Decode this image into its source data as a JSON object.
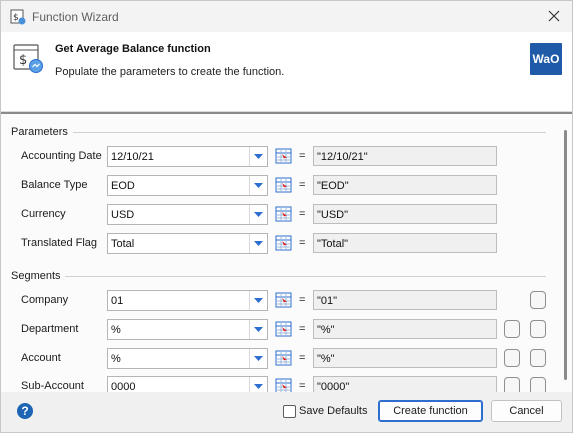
{
  "window": {
    "title": "Function Wizard",
    "close_icon": "close-icon",
    "app_icon": "function-wizard-icon"
  },
  "header": {
    "title": "Get Average Balance function",
    "subtitle": "Populate the parameters to create the function.",
    "logo_text": "WaO",
    "logo_color": "#1e5aa8"
  },
  "parameters": {
    "section_label": "Parameters",
    "rows": [
      {
        "label": "Accounting Date",
        "value": "12/10/21",
        "result": "\"12/10/21\""
      },
      {
        "label": "Balance Type",
        "value": "EOD",
        "result": "\"EOD\""
      },
      {
        "label": "Currency",
        "value": "USD",
        "result": "\"USD\""
      },
      {
        "label": "Translated Flag",
        "value": "Total",
        "result": "\"Total\""
      }
    ]
  },
  "segments": {
    "section_label": "Segments",
    "rows": [
      {
        "label": "Company",
        "value": "01",
        "result": "\"01\""
      },
      {
        "label": "Department",
        "value": "%",
        "result": "\"%\""
      },
      {
        "label": "Account",
        "value": "%",
        "result": "\"%\""
      },
      {
        "label": "Sub-Account",
        "value": "0000",
        "result": "\"0000\""
      }
    ]
  },
  "equals_sign": "=",
  "footer": {
    "help_icon": "help-icon",
    "save_defaults_label": "Save Defaults",
    "save_defaults_checked": false,
    "create_label": "Create function",
    "cancel_label": "Cancel"
  },
  "colors": {
    "accent": "#2d6ecf",
    "help": "#1e64b4"
  }
}
